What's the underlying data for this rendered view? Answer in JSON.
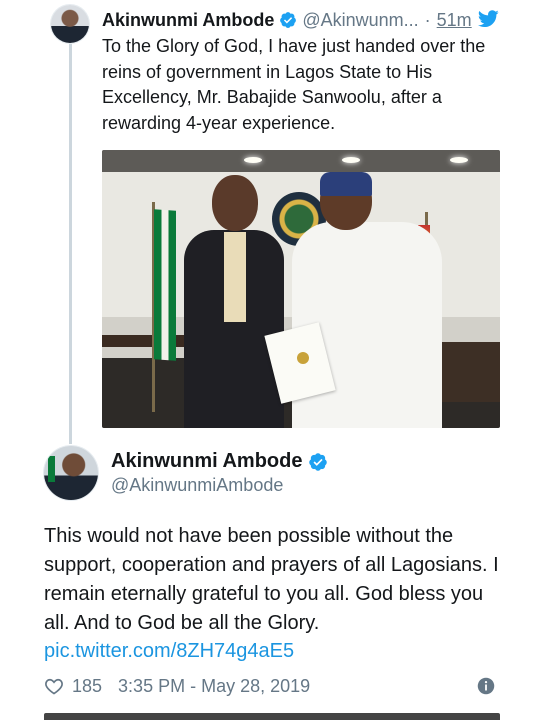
{
  "tweet1": {
    "name": "Akinwunmi Ambode",
    "handle": "@Akinwunm...",
    "separator": "·",
    "time": "51m",
    "text": "To the Glory of God, I have just handed over the reins of government in Lagos State to His Excellency, Mr. Babajide Sanwoolu, after a rewarding 4-year experience."
  },
  "tweet2": {
    "name": "Akinwunmi Ambode",
    "handle": "@AkinwunmiAmbode",
    "text": "This would not have been possible without the support, cooperation and prayers of all Lagosians. I remain eternally grateful to you all. God bless you all. And to God be all the Glory.",
    "link": "pic.twitter.com/8ZH74g4aE5",
    "likes": "185",
    "timestamp": "3:35 PM - May 28, 2019"
  },
  "icons": {
    "verified": "verified-badge-icon",
    "twitter": "twitter-bird-icon",
    "like": "heart-icon",
    "info": "info-icon"
  },
  "colors": {
    "accent": "#1da1f2",
    "link": "#1b95e0",
    "muted": "#657786",
    "thread_line": "#ccd6dd"
  }
}
